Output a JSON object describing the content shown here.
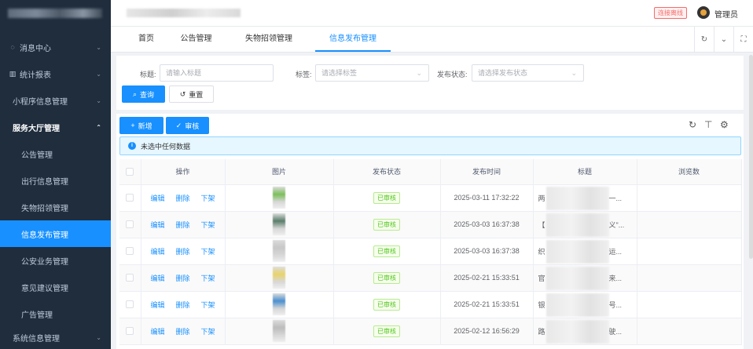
{
  "sidebar": {
    "menus": [
      {
        "label": "消息中心",
        "icon": "message-icon"
      },
      {
        "label": "统计报表",
        "icon": "chart-icon"
      },
      {
        "label": "小程序信息管理",
        "icon": ""
      },
      {
        "label": "服务大厅管理",
        "icon": ""
      }
    ],
    "sub_items": [
      {
        "label": "公告管理"
      },
      {
        "label": "出行信息管理"
      },
      {
        "label": "失物招领管理"
      },
      {
        "label": "信息发布管理"
      },
      {
        "label": "公安业务管理"
      },
      {
        "label": "意见建议管理"
      },
      {
        "label": "广告管理"
      }
    ],
    "bottom_menu": {
      "label": "系统信息管理"
    }
  },
  "header": {
    "status_badge": "连接离线",
    "username": "管理员"
  },
  "tabs": [
    {
      "label": "首页"
    },
    {
      "label": "公告管理"
    },
    {
      "label": "失物招领管理"
    },
    {
      "label": "信息发布管理"
    }
  ],
  "search": {
    "title_label": "标题:",
    "title_placeholder": "请输入标题",
    "tag_label": "标签:",
    "tag_placeholder": "请选择标签",
    "status_label": "发布状态:",
    "status_placeholder": "请选择发布状态",
    "query_button": "查询",
    "reset_button": "重置"
  },
  "toolbar": {
    "add_button": "新增",
    "audit_button": "审核"
  },
  "alert": {
    "text": "未选中任何数据"
  },
  "table": {
    "headers": [
      "操作",
      "图片",
      "发布状态",
      "发布时间",
      "标题",
      "浏览数"
    ],
    "actions": [
      "编辑",
      "删除",
      "下架"
    ],
    "rows": [
      {
        "status": "已审核",
        "time": "2025-03-11 17:32:22",
        "title_start": "两",
        "title_end": "一...",
        "thumb_color": "#7cbf5a"
      },
      {
        "status": "已审核",
        "time": "2025-03-03 16:37:38",
        "title_start": "【",
        "title_end": "义\"...",
        "thumb_color": "#5a7d6a"
      },
      {
        "status": "已审核",
        "time": "2025-03-03 16:37:38",
        "title_start": "织",
        "title_end": "运...",
        "thumb_color": "#c8c8c8"
      },
      {
        "status": "已审核",
        "time": "2025-02-21 15:33:51",
        "title_start": "官",
        "title_end": "来...",
        "thumb_color": "#e8d36a"
      },
      {
        "status": "已审核",
        "time": "2025-02-21 15:33:51",
        "title_start": "银",
        "title_end": "号...",
        "thumb_color": "#4a8fd0"
      },
      {
        "status": "已审核",
        "time": "2025-02-12 16:56:29",
        "title_start": "路",
        "title_end": "驶...",
        "thumb_color": "#bcbcbc"
      }
    ]
  },
  "colors": {
    "sidebar_bg": "#1f2d3d",
    "primary": "#1890ff",
    "success": "#52c41a",
    "danger": "#f56c6c"
  }
}
